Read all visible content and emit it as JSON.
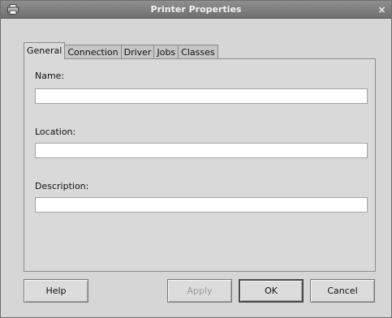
{
  "window": {
    "title": "Printer Properties",
    "close_glyph": "×",
    "app_icon": "printer-icon"
  },
  "tabs": [
    {
      "label": "General",
      "active": true
    },
    {
      "label": "Connection",
      "active": false
    },
    {
      "label": "Driver",
      "active": false
    },
    {
      "label": "Jobs",
      "active": false
    },
    {
      "label": "Classes",
      "active": false
    }
  ],
  "fields": {
    "name": {
      "label": "Name:",
      "value": ""
    },
    "location": {
      "label": "Location:",
      "value": ""
    },
    "description": {
      "label": "Description:",
      "value": ""
    }
  },
  "buttons": {
    "help": "Help",
    "apply": "Apply",
    "ok": "OK",
    "cancel": "Cancel"
  }
}
